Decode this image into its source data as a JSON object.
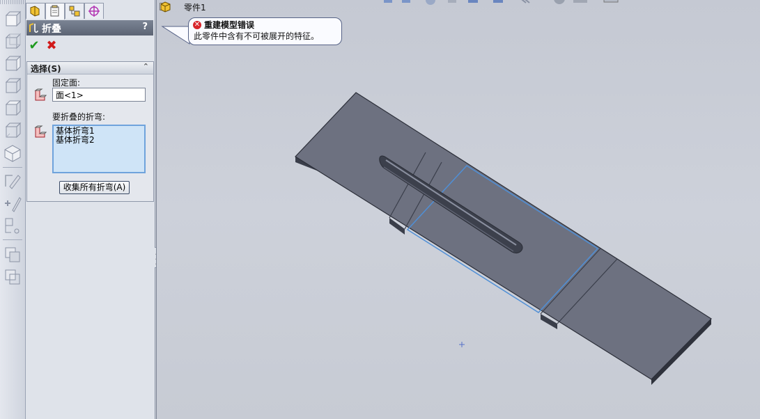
{
  "tree": {
    "expand_symbol": "+",
    "part_name": "零件1"
  },
  "tabs": [
    {
      "icon": "feature-manager-icon"
    },
    {
      "icon": "property-manager-icon"
    },
    {
      "icon": "configuration-manager-icon"
    },
    {
      "icon": "dimxpert-manager-icon"
    }
  ],
  "property_manager": {
    "title": "折叠",
    "help": "?",
    "ok_symbol": "✔",
    "cancel_symbol": "✖",
    "selection_group": {
      "title": "选择(S)",
      "collapse_symbol": "⌃",
      "fixed_face_label": "固定面:",
      "fixed_face_value": "面<1>",
      "bends_label": "要折叠的折弯:",
      "bends": [
        "基体折弯1",
        "基体折弯2"
      ],
      "collect_button": "收集所有折弯(A)"
    }
  },
  "error_tooltip": {
    "icon": "error-icon",
    "title": "重建模型错误",
    "message": "此零件中含有不可被展开的特征。"
  },
  "colors": {
    "part_face": "#6d7180",
    "part_edge": "#2b2e38",
    "selection_highlight": "#4f8fd6",
    "tooltip_border": "#566286",
    "error_red": "#d8252b"
  }
}
